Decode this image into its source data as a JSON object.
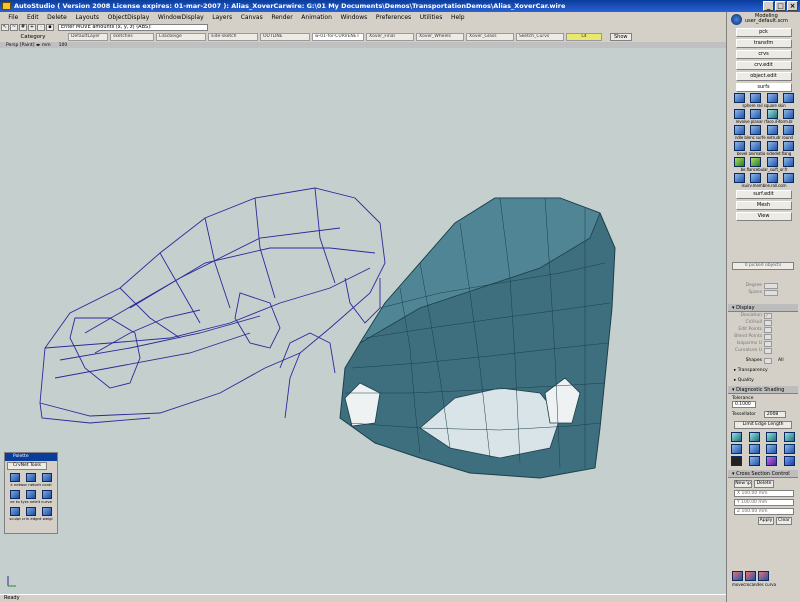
{
  "titlebar": {
    "title": "AutoStudio ( Version 2008 License expires: 01-mar-2007 ): Alias_XoverCarwire: G:\\01 My Documents\\Demos\\TransportationDemos\\Alias_XoverCar.wire"
  },
  "menu": [
    "File",
    "Edit",
    "Delete",
    "Layouts",
    "ObjectDisplay",
    "WindowDisplay",
    "Layers",
    "Canvas",
    "Render",
    "Animation",
    "Windows",
    "Preferences",
    "Utilities",
    "Help"
  ],
  "command": {
    "prompt": "Enter MOVE amounts (x, y, z) (ABS):"
  },
  "layerbar": {
    "category": "Category",
    "tabs": [
      "DefaultLayer",
      "sketches",
      "Lilacbeige",
      "side-sketch",
      "OUTLINE",
      "w-01-for-CURVENET",
      "Xover_Final",
      "Xover_Wheels",
      "Xover_Glass",
      "Sketch_Curvs"
    ],
    "active_index": 5,
    "number": "L4",
    "show_label": "Show"
  },
  "viewbar": {
    "view": "Persp [Paint] ◂▸ mm",
    "zoom": "100"
  },
  "palette": {
    "title": "Palette",
    "tab": "CrvNet Tools",
    "labels1": "k networ netorit conti",
    "labels2": "ve to tyzs netrit curve",
    "labels3": "sculpt crin edgnt weigl"
  },
  "status": "Ready",
  "sidebar": {
    "mode": "Modeling",
    "user": "user_default.scm",
    "buttons_top": [
      "pck",
      "transfm",
      "crvs",
      "crv.edit",
      "object.edit",
      "surfs"
    ],
    "selected": "surfs",
    "icon_labels": [
      "sphere  rail  square  skin",
      "revolve planar rface.iFiform.bl",
      "ndle blenc surfe extrudr round",
      "bevel  animatio sidedet.flang",
      "be.flancebular_suift_or.fr",
      "isuirv.membne.rall.corn"
    ],
    "buttons_bottom": [
      "surf.edit",
      "Mesh",
      "View"
    ]
  },
  "attributes": {
    "picked": "0 picked objects",
    "degree_label": "Degree",
    "spans_label": "Spans",
    "display_header": "Display",
    "display_rows": [
      "Deviation",
      "CV/Hull",
      "Edit Points",
      "Blend Points",
      "Isoparms U",
      "Curvature U"
    ],
    "shapes_label": "Shapes",
    "shapes_value": "All",
    "transparency": "Transparency",
    "quality": "Quality",
    "diag_header": "Diagnostic Shading",
    "tolerance_label": "Tolerance",
    "tolerance_value": "0.1000",
    "tessellator_label": "Tessellator",
    "tessellator_value": "2008",
    "limit_edge": "Limit Edge Length",
    "cross_header": "Cross Section Control",
    "new_label": "New \\p",
    "delete_label": "Delete",
    "x_value": "X 100.00 mm",
    "y_value": "Y 100.00 mm",
    "z_value": "Z 100.00 mm",
    "apply": "Apply",
    "clear": "Clear"
  },
  "bottom_tools": "movecrocandes curva"
}
